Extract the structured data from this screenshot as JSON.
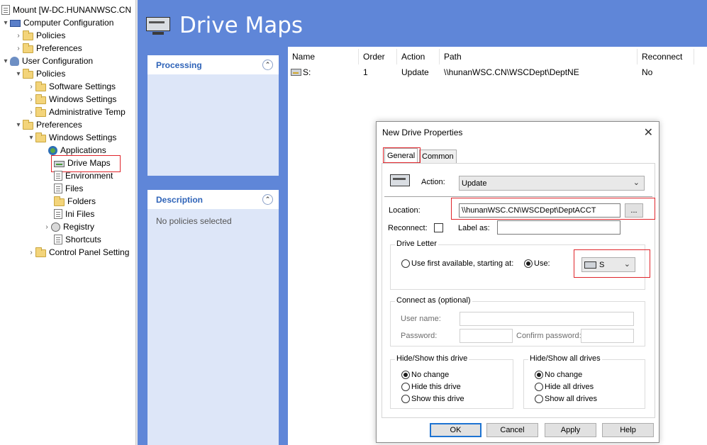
{
  "tree": {
    "root": "Mount [W-DC.HUNANWSC.CN",
    "computer_config": "Computer Configuration",
    "cc_policies": "Policies",
    "cc_preferences": "Preferences",
    "user_config": "User Configuration",
    "uc_policies": "Policies",
    "software_settings": "Software Settings",
    "windows_settings": "Windows Settings",
    "admin_templates": "Administrative Temp",
    "uc_preferences": "Preferences",
    "pref_windows_settings": "Windows Settings",
    "applications": "Applications",
    "drive_maps": "Drive Maps",
    "environment": "Environment",
    "files": "Files",
    "folders": "Folders",
    "ini_files": "Ini Files",
    "registry": "Registry",
    "shortcuts": "Shortcuts",
    "control_panel": "Control Panel Setting"
  },
  "header": {
    "title": "Drive Maps"
  },
  "panels": {
    "processing_title": "Processing",
    "description_title": "Description",
    "description_text": "No policies selected"
  },
  "list": {
    "columns": [
      "Name",
      "Order",
      "Action",
      "Path",
      "Reconnect"
    ],
    "rows": [
      {
        "name": "S:",
        "order": "1",
        "action": "Update",
        "path": "\\\\hunanWSC.CN\\WSCDept\\DeptNE",
        "reconnect": "No"
      }
    ]
  },
  "dialog": {
    "title": "New Drive Properties",
    "close": "✕",
    "tabs": {
      "general": "General",
      "common": "Common"
    },
    "action_label": "Action:",
    "action_value": "Update",
    "location_label": "Location:",
    "location_value": "\\\\hunanWSC.CN\\WSCDept\\DeptACCT",
    "browse_label": "...",
    "reconnect_label": "Reconnect:",
    "label_as_label": "Label as:",
    "label_as_value": "",
    "drive_letter_group": "Drive Letter",
    "use_first_available": "Use first available, starting at:",
    "use_label": "Use:",
    "drive_letter_value": "S",
    "connect_as_group": "Connect as (optional)",
    "user_name_label": "User name:",
    "password_label": "Password:",
    "confirm_password_label": "Confirm password:",
    "hide_show_drive_group": "Hide/Show this drive",
    "hide_show_drive_options": [
      "No change",
      "Hide this drive",
      "Show this drive"
    ],
    "hide_show_all_group": "Hide/Show all drives",
    "hide_show_all_options": [
      "No change",
      "Hide all drives",
      "Show all drives"
    ],
    "buttons": {
      "ok": "OK",
      "cancel": "Cancel",
      "apply": "Apply",
      "help": "Help"
    }
  },
  "icons": {
    "expanded": "▾",
    "collapsed": "›",
    "collapse_up": "⌃",
    "chevron": "⌄"
  },
  "colors": {
    "header_blue": "#5f86d8",
    "panel_title_blue": "#2e63b8",
    "highlight_red": "#e0252b",
    "default_button_blue": "#1d73d2"
  }
}
